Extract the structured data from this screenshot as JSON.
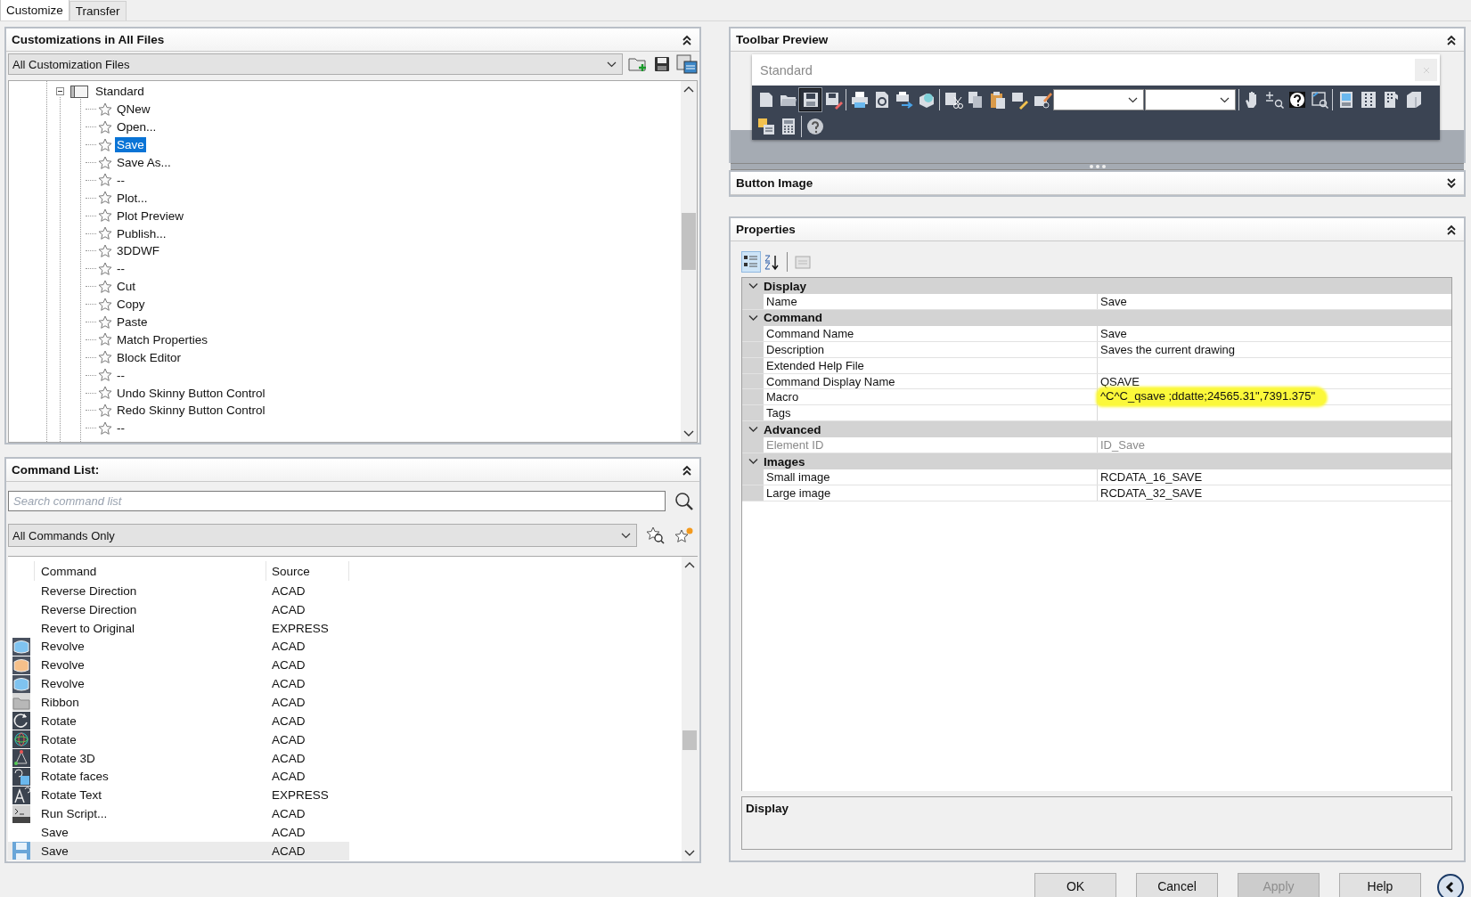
{
  "tabs": [
    {
      "label": "Customize",
      "selected": true
    },
    {
      "label": "Transfer",
      "selected": false
    }
  ],
  "customizations": {
    "title": "Customizations in All Files",
    "expanded": true,
    "file_filter": "All Customization Files",
    "tree": {
      "label": "Standard",
      "expanded": true,
      "children": [
        {
          "label": "QNew",
          "selected": false
        },
        {
          "label": "Open...",
          "selected": false
        },
        {
          "label": "Save",
          "selected": true
        },
        {
          "label": "Save As...",
          "selected": false
        },
        {
          "label": "--",
          "selected": false
        },
        {
          "label": "Plot...",
          "selected": false
        },
        {
          "label": "Plot Preview",
          "selected": false
        },
        {
          "label": "Publish...",
          "selected": false
        },
        {
          "label": "3DDWF",
          "selected": false
        },
        {
          "label": "--",
          "selected": false
        },
        {
          "label": "Cut",
          "selected": false
        },
        {
          "label": "Copy",
          "selected": false
        },
        {
          "label": "Paste",
          "selected": false
        },
        {
          "label": "Match Properties",
          "selected": false
        },
        {
          "label": "Block Editor",
          "selected": false
        },
        {
          "label": "--",
          "selected": false
        },
        {
          "label": "Undo Skinny Button Control",
          "selected": false
        },
        {
          "label": "Redo Skinny Button Control",
          "selected": false
        },
        {
          "label": "--",
          "selected": false
        }
      ]
    }
  },
  "command_list": {
    "title": "Command List:",
    "expanded": true,
    "search": {
      "placeholder": "Search command list"
    },
    "filter": "All Commands Only",
    "columns": [
      "Command",
      "Source"
    ],
    "rows": [
      {
        "command": "Reverse Direction",
        "source": "ACAD",
        "selected": false
      },
      {
        "command": "Reverse Direction",
        "source": "ACAD",
        "selected": false
      },
      {
        "command": "Revert to Original",
        "source": "EXPRESS",
        "selected": false
      },
      {
        "command": "Revolve",
        "source": "ACAD",
        "selected": false
      },
      {
        "command": "Revolve",
        "source": "ACAD",
        "selected": false
      },
      {
        "command": "Revolve",
        "source": "ACAD",
        "selected": false
      },
      {
        "command": "Ribbon",
        "source": "ACAD",
        "selected": false
      },
      {
        "command": "Rotate",
        "source": "ACAD",
        "selected": false
      },
      {
        "command": "Rotate",
        "source": "ACAD",
        "selected": false
      },
      {
        "command": "Rotate 3D",
        "source": "ACAD",
        "selected": false
      },
      {
        "command": "Rotate faces",
        "source": "ACAD",
        "selected": false
      },
      {
        "command": "Rotate Text",
        "source": "EXPRESS",
        "selected": false
      },
      {
        "command": "Run Script...",
        "source": "ACAD",
        "selected": false
      },
      {
        "command": "Save",
        "source": "ACAD",
        "selected": false
      },
      {
        "command": "Save",
        "source": "ACAD",
        "selected": true
      }
    ]
  },
  "toolbar_preview": {
    "title": "Toolbar Preview",
    "expanded": true,
    "toolbar_name": "Standard",
    "buttons": [
      {
        "selected": false
      },
      {
        "selected": false
      },
      {
        "selected": true
      },
      {
        "selected": false
      },
      {
        "selected": false
      },
      {
        "selected": false
      },
      {
        "selected": false
      },
      {
        "selected": false
      },
      {
        "selected": false
      },
      {
        "selected": false
      },
      {
        "selected": false
      },
      {
        "selected": false
      },
      {
        "selected": false
      },
      {
        "selected": false
      },
      {
        "selected": false
      },
      {
        "selected": false
      },
      {
        "selected": false
      },
      {
        "selected": false
      },
      {
        "selected": false
      },
      {
        "selected": false
      },
      {
        "selected": false
      },
      {
        "selected": false
      },
      {
        "selected": false
      },
      {
        "selected": false
      }
    ]
  },
  "button_image": {
    "title": "Button Image",
    "expanded": false
  },
  "properties": {
    "title": "Properties",
    "expanded": true,
    "view_modes": [
      {
        "selected": true
      },
      {
        "selected": false
      },
      {
        "selected": false
      }
    ],
    "categories": [
      {
        "name": "Display",
        "expanded": true,
        "rows": [
          {
            "name": "Name",
            "value": "Save",
            "disabled": false,
            "highlighted": false
          }
        ]
      },
      {
        "name": "Command",
        "expanded": true,
        "rows": [
          {
            "name": "Command Name",
            "value": "Save",
            "disabled": false,
            "highlighted": false
          },
          {
            "name": "Description",
            "value": "Saves the current drawing",
            "disabled": false,
            "highlighted": false
          },
          {
            "name": "Extended Help File",
            "value": "",
            "disabled": false,
            "highlighted": false
          },
          {
            "name": "Command Display Name",
            "value": "QSAVE",
            "disabled": false,
            "highlighted": false
          },
          {
            "name": "Macro",
            "value": "^C^C_qsave ;ddatte;24565.31\",7391.375\"",
            "disabled": false,
            "highlighted": true
          },
          {
            "name": "Tags",
            "value": "",
            "disabled": false,
            "highlighted": false
          }
        ]
      },
      {
        "name": "Advanced",
        "expanded": true,
        "rows": [
          {
            "name": "Element ID",
            "value": "ID_Save",
            "disabled": true,
            "highlighted": false
          }
        ]
      },
      {
        "name": "Images",
        "expanded": true,
        "rows": [
          {
            "name": "Small image",
            "value": "RCDATA_16_SAVE",
            "disabled": false,
            "highlighted": false
          },
          {
            "name": "Large image",
            "value": "RCDATA_32_SAVE",
            "disabled": false,
            "highlighted": false
          }
        ]
      }
    ],
    "description": {
      "title": "Display"
    }
  },
  "buttons": [
    {
      "label": "OK",
      "disabled": false
    },
    {
      "label": "Cancel",
      "disabled": false
    },
    {
      "label": "Apply",
      "disabled": true
    },
    {
      "label": "Help",
      "disabled": false
    }
  ]
}
